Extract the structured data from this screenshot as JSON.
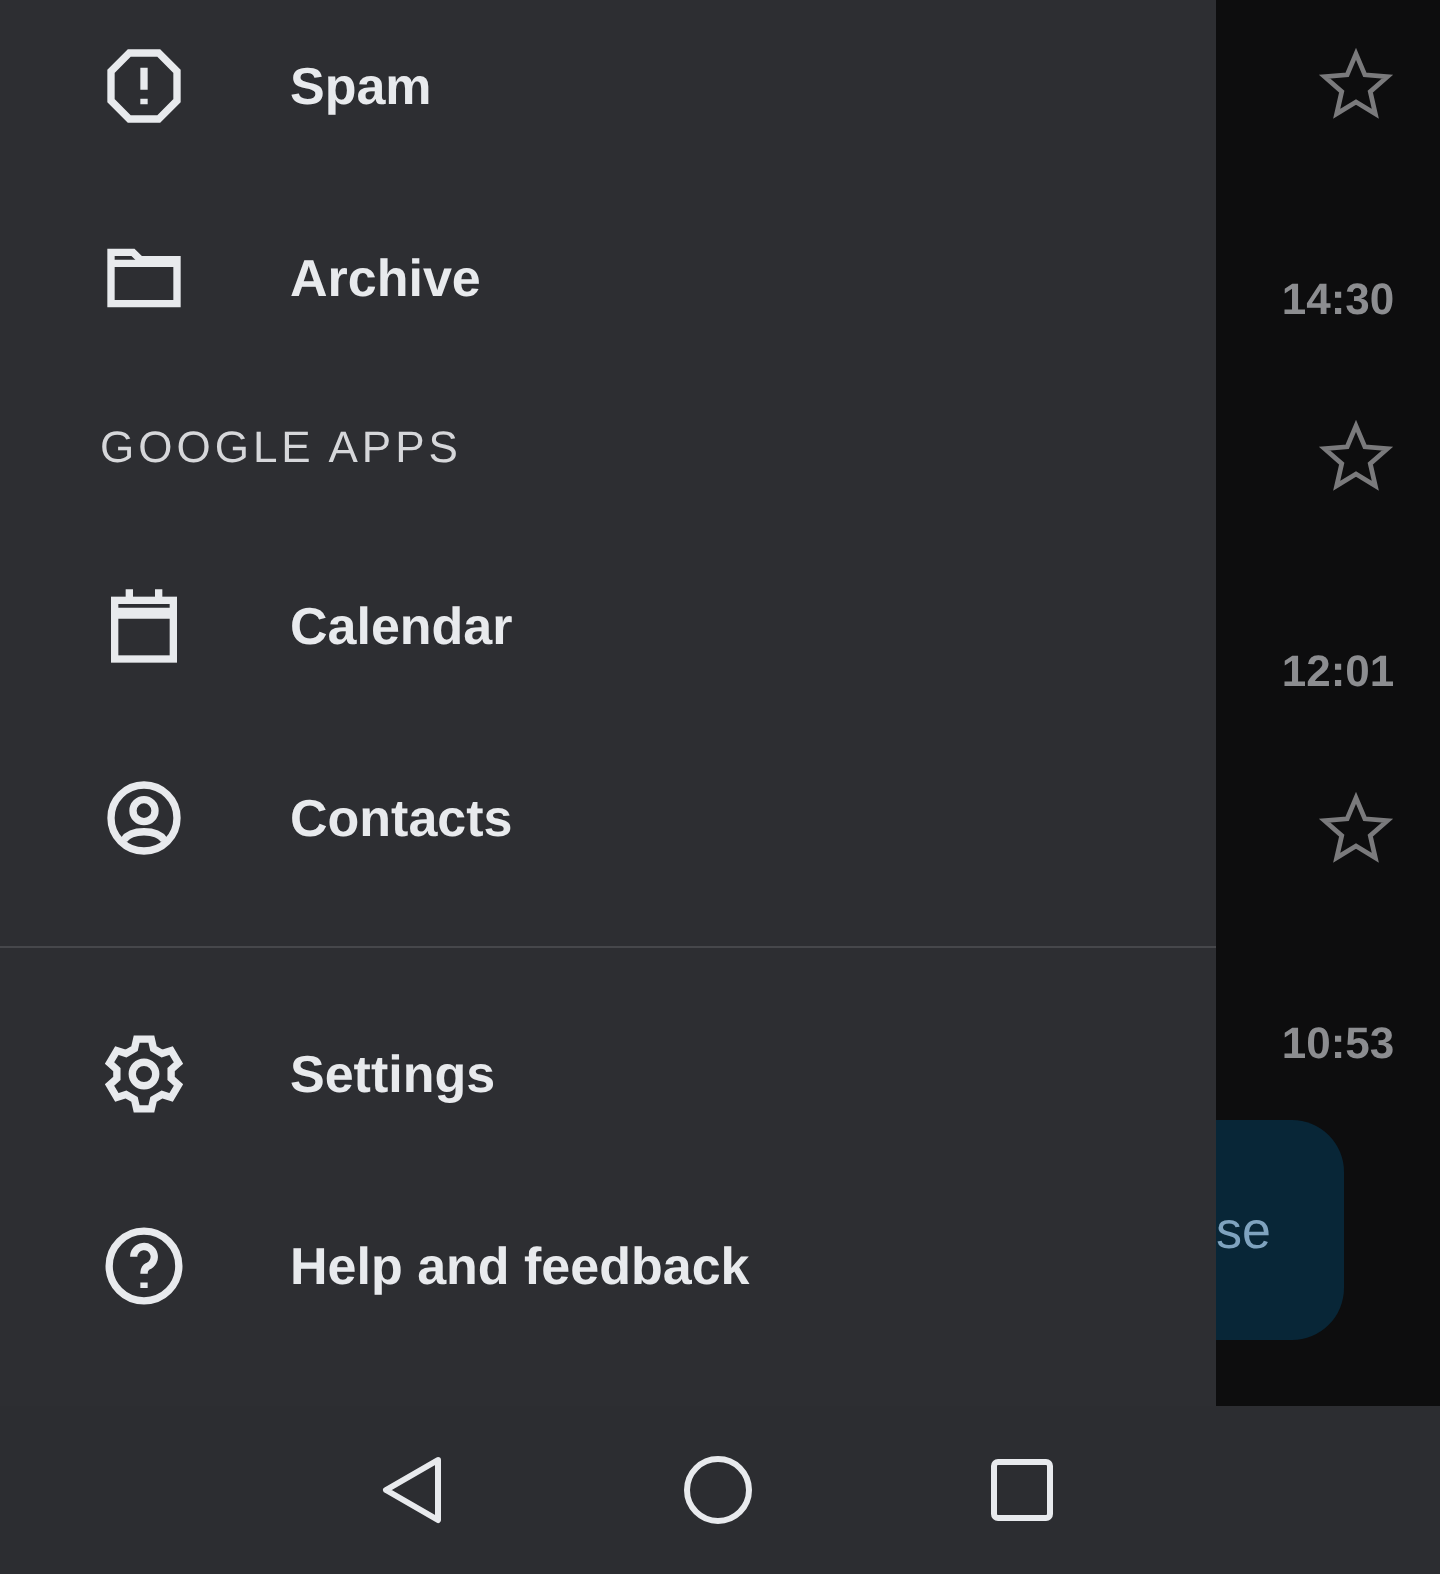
{
  "drawer": {
    "items": [
      {
        "kind": "item",
        "label": "Spam",
        "selected": false
      },
      {
        "kind": "item",
        "label": "Archive",
        "selected": false
      },
      {
        "kind": "header",
        "label": "GOOGLE APPS"
      },
      {
        "kind": "item",
        "label": "Calendar",
        "selected": false
      },
      {
        "kind": "item",
        "label": "Contacts",
        "selected": false
      },
      {
        "kind": "divider"
      },
      {
        "kind": "item",
        "label": "Settings",
        "selected": false
      },
      {
        "kind": "item",
        "label": "Help and feedback",
        "selected": false
      }
    ]
  },
  "mail_list": {
    "rows": [
      {
        "time": "14:30",
        "starred": false
      },
      {
        "time": "12:01",
        "starred": false
      },
      {
        "time": "10:53",
        "starred": false
      }
    ]
  },
  "compose_button": {
    "label": "se"
  }
}
